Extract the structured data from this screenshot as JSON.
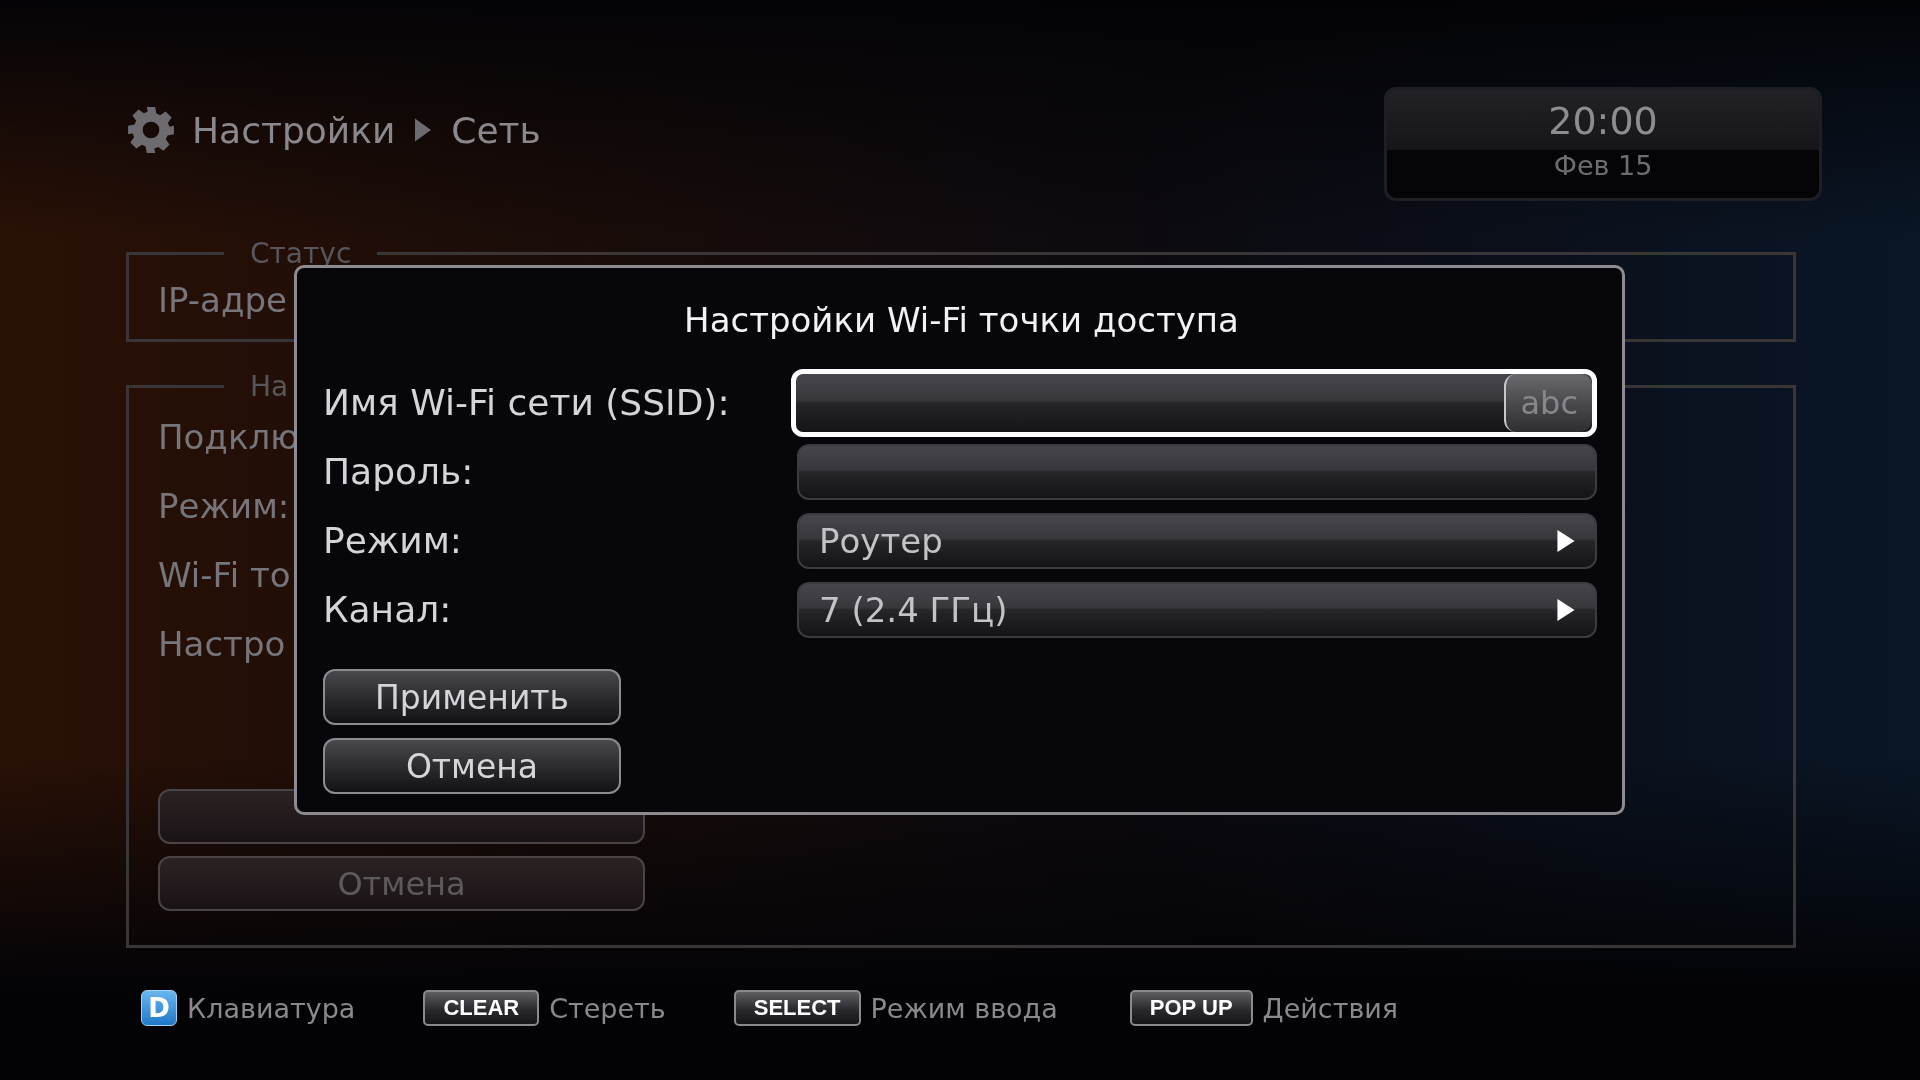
{
  "header": {
    "breadcrumb": [
      "Настройки",
      "Сеть"
    ]
  },
  "clock": {
    "time": "20:00",
    "date": "Фев 15"
  },
  "background": {
    "panels": [
      {
        "legend": "Статус",
        "rows": [
          "IP-адре"
        ]
      },
      {
        "legend": "На",
        "rows": [
          "Подклю",
          "Режим:",
          "Wi-Fi то",
          "Настро"
        ],
        "buttons": [
          {
            "kind": "button"
          },
          {
            "kind": "button",
            "label": "Отмена"
          }
        ]
      }
    ]
  },
  "dialog": {
    "title": "Настройки Wi-Fi точки доступа",
    "fields": [
      {
        "label": "Имя Wi-Fi сети (SSID):",
        "kind": "text",
        "focused": true,
        "badge": "abc"
      },
      {
        "label": "Пароль:",
        "kind": "text",
        "focused": false
      },
      {
        "label": "Режим:",
        "kind": "select",
        "focused": false,
        "value": "Роутер"
      },
      {
        "label": "Канал:",
        "kind": "select",
        "focused": false,
        "value": "7 (2.4 ГГц)"
      }
    ],
    "buttons": [
      "Применить",
      "Отмена"
    ]
  },
  "footer": [
    {
      "kind": "color",
      "key": "D",
      "label": "Клавиатура"
    },
    {
      "kind": "key",
      "key": "CLEAR",
      "label": "Стереть"
    },
    {
      "kind": "key",
      "key": "SELECT",
      "label": "Режим ввода"
    },
    {
      "kind": "key",
      "key": "POP UP",
      "label": "Действия"
    }
  ]
}
